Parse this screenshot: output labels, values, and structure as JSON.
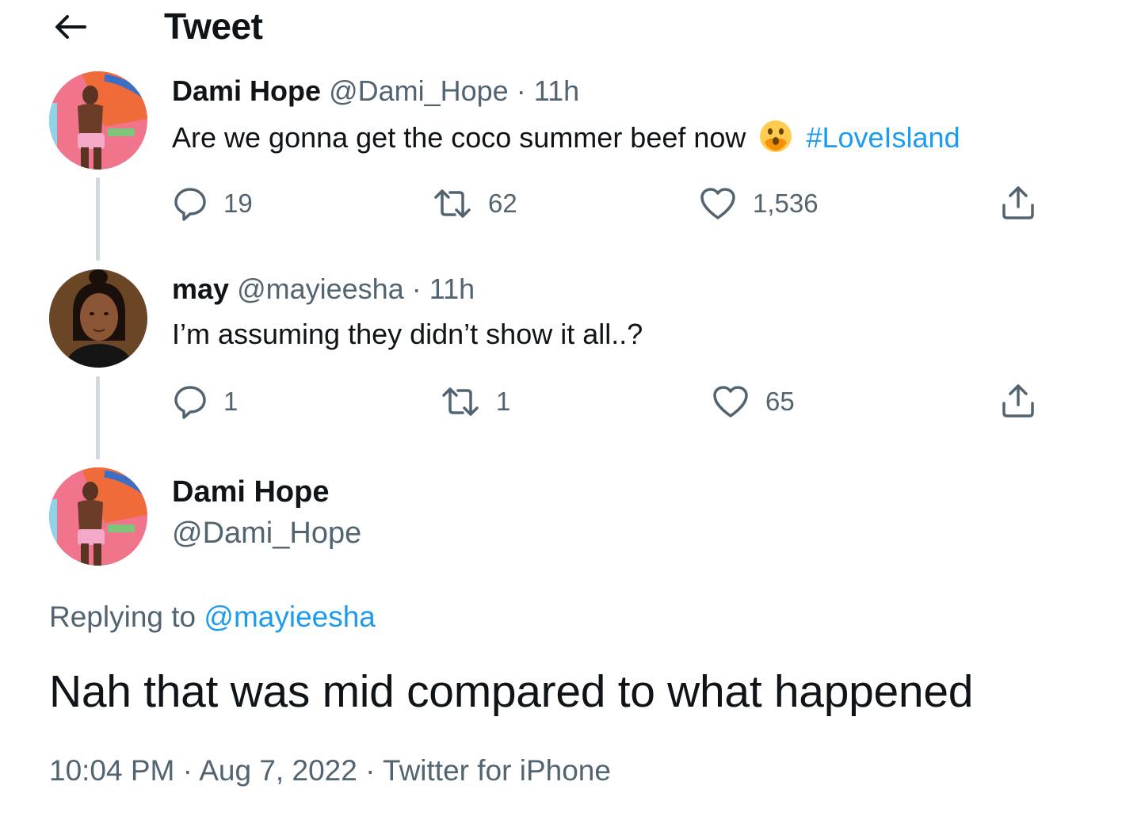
{
  "header": {
    "title": "Tweet"
  },
  "thread": [
    {
      "name": "Dami Hope",
      "handle": "@Dami_Hope",
      "separator": "·",
      "time": "11h",
      "text": "Are we gonna get the coco summer beef now",
      "emoji": "face-with-open-eyes-and-hand-over-mouth",
      "hashtag": "#LoveIsland",
      "replies": "19",
      "retweets": "62",
      "likes": "1,536"
    },
    {
      "name": "may",
      "handle": "@mayieesha",
      "separator": "·",
      "time": "11h",
      "text": "I’m assuming they didn’t show it all..?",
      "replies": "1",
      "retweets": "1",
      "likes": "65"
    }
  ],
  "main": {
    "name": "Dami Hope",
    "handle": "@Dami_Hope",
    "replying_prefix": "Replying to",
    "replying_to": "@mayieesha",
    "text": "Nah that was mid compared to what happened",
    "time": "10:04 PM",
    "separator": "·",
    "date": "Aug 7, 2022",
    "source": "Twitter for iPhone"
  },
  "colors": {
    "link": "#1d9bf0",
    "secondary_text": "#536471",
    "thread_line": "#cfd9de"
  }
}
